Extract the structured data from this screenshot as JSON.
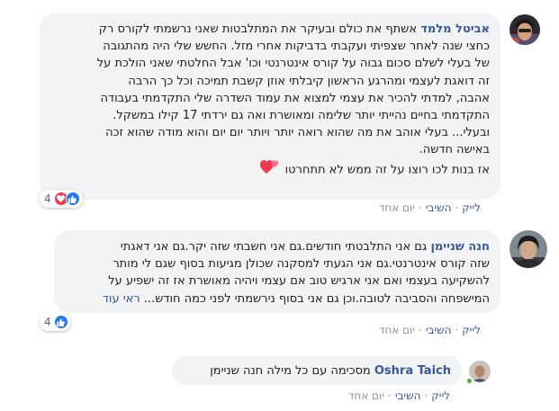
{
  "comments": [
    {
      "author": "אביטל מלמד",
      "text_lines": [
        "אשתף את כולם ובעיקר את המתלבטות שאני נרשמתי לקורס רק",
        "כחצי שנה לאחר שצפיתי ועקבתי בדביקות אחרי מזל. החשש שלי היה מהתגובה",
        "של בעלי לשלם סכום גבוה על קורס אינטרנטי וכו' אבל החלטתי שאני הולכת על",
        "זה דואגת לעצמי ומהרגע הראשון קיבלתי אוזן קשבת תמיכה וכל כך הרבה",
        "אהבה, למדתי להכיר את עצמי למצוא את עמוד השדרה שלי התקדמתי בעבודה",
        "התקדמתי בחיים נהייתי יותר שלימה ומאושרת ואה גם ירדתי 17 קילו במשקל.",
        "ובעלי... בעלי אוהב את מה שהוא רואה יותר ויותר יום יום והוא מודה שהוא זכה",
        "באישה חדשה.",
        "אז בנות לכו רוצו על זה ממש לא תתחרטו"
      ],
      "emoji": "two-hearts",
      "reaction_count": "4",
      "actions": {
        "like": "לייק",
        "reply": "השיבי",
        "time": "יום אחד"
      }
    },
    {
      "author": "חנה שניימן",
      "text_lines": [
        "גם אני התלבטתי חודשים.גם אני חשבתי שזה יקר.גם אני דאגתי",
        "שזה קורס אינטרנטי.גם אני הגעתי למסקנה שכולן מגיעות בסוף שגם לי מותר",
        "להשקיעה בעצמי ואם אני ארגיש טוב אם עצמי ויהיה מאושרת אז זה ישפיע על",
        "המישפחה והסביבה לטובה.וכן גם אני בסוף נירשמתי לפני כמה חודש..."
      ],
      "see_more": "ראי עוד",
      "reaction_count": "4",
      "actions": {
        "like": "לייק",
        "reply": "השיבי",
        "time": "יום אחד"
      }
    },
    {
      "author": "Oshra Taich",
      "text": "מסכימה עם כל מילה חנה שניימן",
      "actions": {
        "like": "לייק",
        "reply": "השיבי",
        "time": "יום אחד"
      }
    }
  ],
  "colors": {
    "author_link": "#385898",
    "bubble_bg": "#f2f3f5",
    "like_blue": "#2078f4",
    "love_red": "#f0384f",
    "meta_gray": "#90949c",
    "online_green": "#42b72a"
  }
}
